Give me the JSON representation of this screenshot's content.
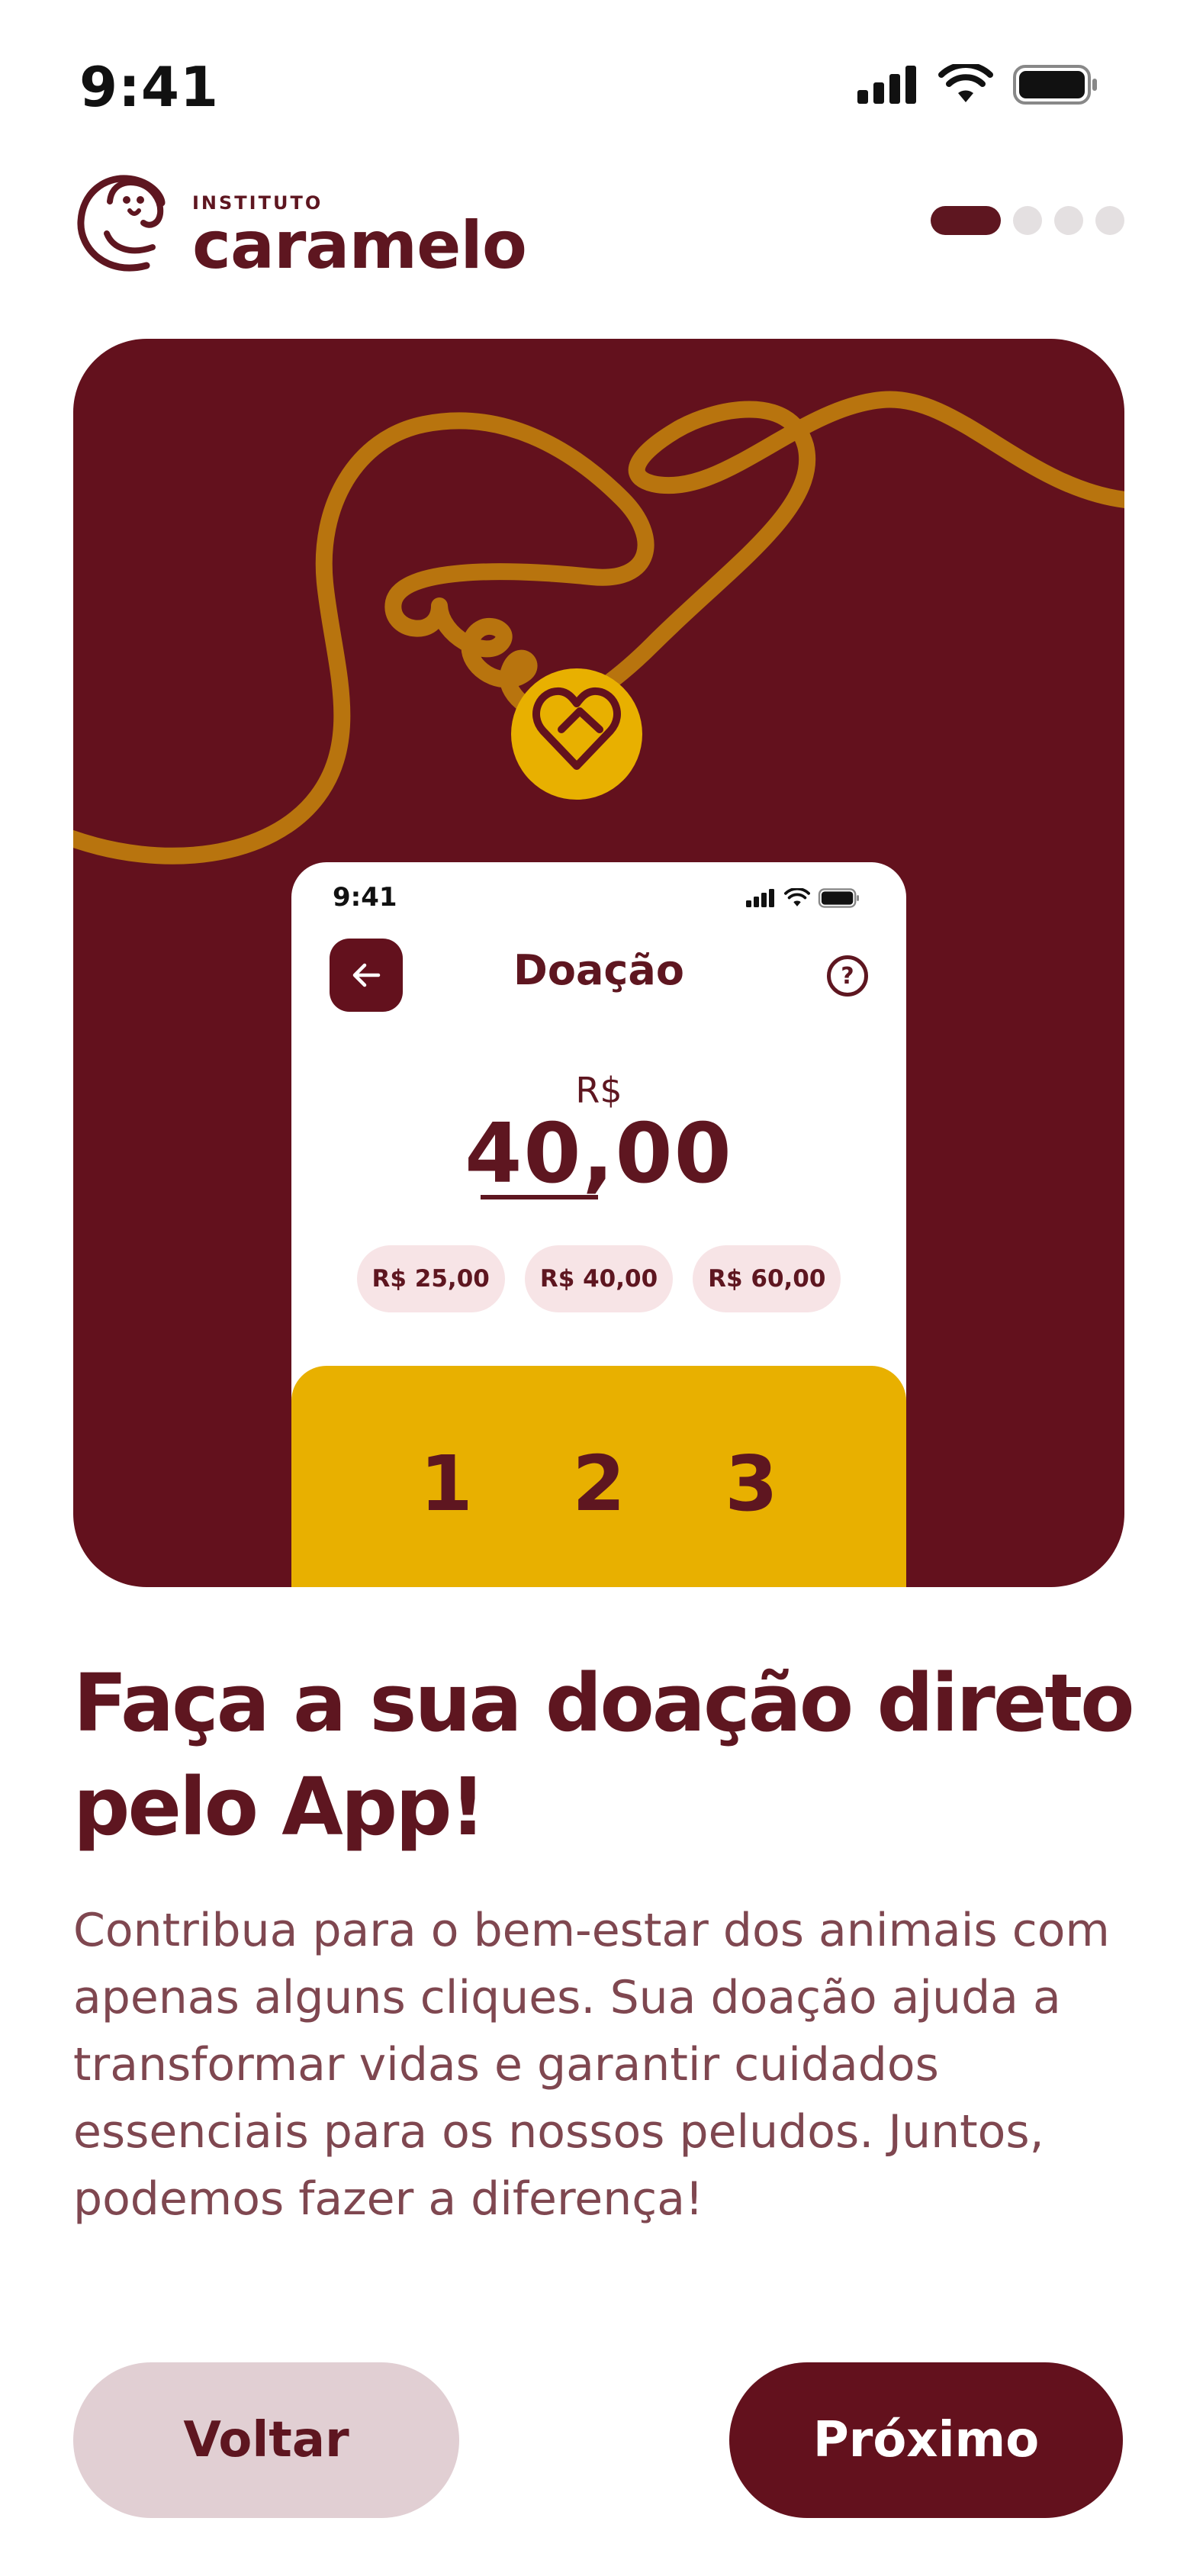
{
  "status_bar": {
    "time": "9:41"
  },
  "header": {
    "logo_small": "INSTITUTO",
    "logo_big": "caramelo",
    "pager": {
      "total": 4,
      "active": 1
    }
  },
  "hero": {
    "phone": {
      "time": "9:41",
      "title": "Doação",
      "help": "?",
      "currency": "R$",
      "amount": "40,00",
      "chips": [
        "R$ 25,00",
        "R$ 40,00",
        "R$ 60,00"
      ],
      "keys": [
        "1",
        "2",
        "3"
      ]
    }
  },
  "content": {
    "headline": "Faça a sua doação direto pelo App!",
    "body": "Contribua para o bem-estar dos animais com apenas alguns cliques. Sua doação ajuda a transformar vidas e garantir cuidados essenciais para os nossos peludos. Juntos, podemos fazer a diferença!"
  },
  "buttons": {
    "back": "Voltar",
    "next": "Próximo"
  },
  "colors": {
    "brand": "#63111d",
    "accent": "#e8b000",
    "rope": "#b8740e"
  }
}
